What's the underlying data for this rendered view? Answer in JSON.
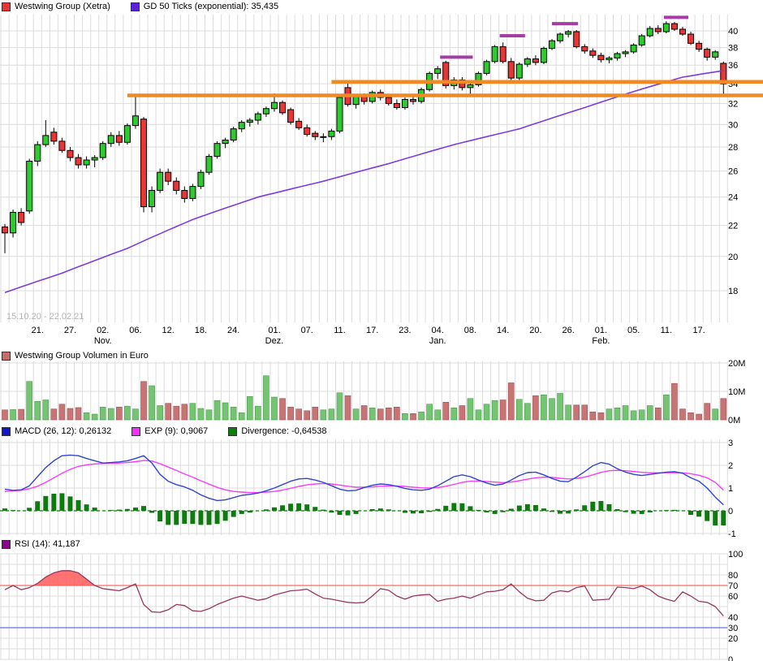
{
  "header": {
    "series_label": "Westwing Group (Xetra)",
    "ma_label": "GD 50 Ticks (exponential): 35,435"
  },
  "price_panel": {
    "date_range": "15.10.20 - 22.02.21",
    "yticks": [
      40,
      38,
      36,
      34,
      32,
      30,
      28,
      26,
      24,
      22,
      20,
      18
    ]
  },
  "volume_panel": {
    "label": "Westwing Group Volumen in Euro",
    "yticks": [
      {
        "label": "20M",
        "value": 20
      },
      {
        "label": "10M",
        "value": 10
      },
      {
        "label": "0M",
        "value": 0
      }
    ]
  },
  "macd_panel": {
    "macd_label": "MACD (26, 12): 0,26132",
    "exp_label": "EXP (9): 0,9067",
    "divergence_label": "Divergence: -0,64538",
    "yticks": [
      3,
      2,
      1,
      0,
      -1
    ]
  },
  "rsi_panel": {
    "label": "RSI (14): 41,187",
    "yticks": [
      100,
      80,
      70,
      60,
      40,
      30,
      20,
      0
    ],
    "overbought_level": 70,
    "oversold_level": 30
  },
  "colors": {
    "grid": "#dcdcdc",
    "candle_up": "#2fca2f",
    "candle_down": "#e83535",
    "candle_stroke": "#000000",
    "ma_line": "#7d3be0",
    "resistance_orange": "#f18a22",
    "peak_marker": "#a53da5",
    "vol_up": "#74c474",
    "vol_down": "#c97474",
    "macd_line": "#2f45d4",
    "exp_line": "#f93df9",
    "hist": "#0f7a0f",
    "rsi_line": "#96385f",
    "rsi_fill": "#ff5a5a",
    "level70": "#f07060",
    "level30": "#6a6af0",
    "muted_text": "#b4b4b4",
    "swatch_series": "#e83535",
    "swatch_ma": "#5b21d8",
    "swatch_volume": "#c96a6a",
    "swatch_macd": "#1515d0",
    "swatch_exp": "#f92df9",
    "swatch_div": "#0f7a0f",
    "swatch_rsi": "#8b008b"
  },
  "chart_data": [
    {
      "type": "candlestick",
      "title": "Westwing Group (Xetra)",
      "scale": "log",
      "ylim": [
        17.5,
        42.2
      ],
      "legend_position": "top-left",
      "grid": true,
      "candles": [
        [
          21.9,
          22.1,
          20.2,
          21.5
        ],
        [
          21.5,
          23.1,
          21.2,
          22.9
        ],
        [
          22.9,
          23.2,
          22.0,
          22.2
        ],
        [
          23.0,
          27.0,
          22.8,
          26.8
        ],
        [
          26.8,
          28.5,
          26.4,
          28.2
        ],
        [
          28.2,
          30.4,
          28.0,
          29.0
        ],
        [
          29.3,
          29.7,
          28.2,
          28.5
        ],
        [
          28.5,
          28.8,
          27.5,
          27.7
        ],
        [
          27.7,
          28.0,
          26.8,
          27.1
        ],
        [
          27.1,
          27.4,
          26.2,
          26.5
        ],
        [
          26.5,
          27.2,
          26.2,
          26.9
        ],
        [
          26.9,
          27.3,
          26.3,
          27.1
        ],
        [
          27.1,
          28.5,
          26.9,
          28.3
        ],
        [
          28.3,
          29.3,
          28.0,
          29.0
        ],
        [
          29.0,
          29.4,
          28.1,
          28.4
        ],
        [
          28.4,
          30.1,
          28.2,
          29.9
        ],
        [
          29.9,
          32.9,
          29.6,
          30.8
        ],
        [
          30.5,
          30.7,
          22.9,
          23.3
        ],
        [
          23.3,
          24.8,
          22.9,
          24.5
        ],
        [
          24.5,
          26.2,
          24.3,
          25.9
        ],
        [
          25.9,
          26.2,
          24.9,
          25.2
        ],
        [
          25.2,
          25.5,
          24.2,
          24.5
        ],
        [
          24.5,
          24.8,
          23.6,
          23.9
        ],
        [
          23.9,
          25.0,
          23.7,
          24.8
        ],
        [
          24.8,
          26.1,
          24.6,
          25.9
        ],
        [
          25.9,
          27.4,
          25.7,
          27.2
        ],
        [
          27.2,
          28.5,
          27.0,
          28.3
        ],
        [
          28.3,
          28.8,
          27.9,
          28.6
        ],
        [
          28.6,
          29.8,
          28.4,
          29.6
        ],
        [
          29.6,
          30.4,
          29.3,
          30.2
        ],
        [
          30.2,
          30.6,
          29.8,
          30.4
        ],
        [
          30.4,
          31.2,
          30.0,
          31.0
        ],
        [
          31.0,
          31.7,
          30.7,
          31.5
        ],
        [
          31.5,
          33.0,
          31.2,
          32.1
        ],
        [
          32.1,
          32.3,
          30.9,
          31.1
        ],
        [
          31.4,
          31.6,
          30.0,
          30.2
        ],
        [
          30.3,
          30.6,
          29.5,
          29.7
        ],
        [
          29.7,
          30.0,
          28.9,
          29.1
        ],
        [
          29.2,
          29.4,
          28.6,
          28.9
        ],
        [
          28.9,
          29.2,
          28.4,
          28.9
        ],
        [
          28.9,
          29.6,
          28.6,
          29.4
        ],
        [
          29.4,
          32.8,
          29.2,
          32.6
        ],
        [
          33.6,
          34.3,
          31.7,
          31.9
        ],
        [
          31.9,
          32.9,
          31.5,
          32.7
        ],
        [
          32.7,
          33.0,
          31.9,
          32.2
        ],
        [
          32.2,
          33.3,
          32.0,
          33.1
        ],
        [
          33.1,
          33.4,
          32.3,
          32.6
        ],
        [
          32.6,
          32.9,
          31.8,
          32.0
        ],
        [
          32.0,
          32.4,
          31.4,
          31.6
        ],
        [
          31.6,
          32.6,
          31.4,
          32.4
        ],
        [
          32.4,
          32.8,
          31.9,
          32.2
        ],
        [
          32.2,
          33.6,
          32.0,
          33.4
        ],
        [
          33.4,
          35.3,
          33.2,
          35.1
        ],
        [
          35.1,
          35.9,
          34.5,
          35.6
        ],
        [
          36.3,
          36.5,
          33.5,
          33.8
        ],
        [
          33.8,
          34.7,
          33.4,
          34.4
        ],
        [
          34.4,
          34.7,
          33.3,
          33.6
        ],
        [
          33.6,
          34.1,
          32.9,
          33.9
        ],
        [
          33.9,
          35.3,
          33.7,
          35.1
        ],
        [
          35.1,
          36.6,
          34.9,
          36.4
        ],
        [
          36.4,
          38.3,
          36.2,
          38.1
        ],
        [
          38.1,
          38.6,
          36.2,
          36.4
        ],
        [
          36.4,
          36.8,
          34.2,
          34.6
        ],
        [
          34.6,
          36.3,
          34.4,
          36.1
        ],
        [
          36.1,
          36.9,
          35.8,
          36.7
        ],
        [
          36.7,
          37.1,
          36.0,
          36.3
        ],
        [
          36.3,
          38.1,
          36.1,
          37.9
        ],
        [
          37.9,
          39.0,
          37.7,
          38.8
        ],
        [
          38.8,
          39.8,
          38.5,
          39.6
        ],
        [
          39.6,
          40.1,
          39.2,
          39.9
        ],
        [
          39.9,
          40.1,
          37.9,
          38.1
        ],
        [
          38.1,
          38.4,
          37.3,
          37.6
        ],
        [
          37.6,
          37.9,
          36.8,
          37.1
        ],
        [
          37.1,
          37.4,
          36.3,
          36.6
        ],
        [
          36.6,
          37.0,
          36.2,
          36.8
        ],
        [
          36.8,
          37.5,
          36.5,
          37.3
        ],
        [
          37.3,
          37.7,
          36.9,
          37.5
        ],
        [
          37.5,
          38.5,
          37.3,
          38.3
        ],
        [
          38.3,
          39.6,
          38.1,
          39.4
        ],
        [
          39.4,
          40.6,
          39.2,
          40.3
        ],
        [
          40.3,
          40.7,
          39.6,
          39.9
        ],
        [
          39.9,
          41.2,
          39.7,
          40.9
        ],
        [
          40.9,
          41.1,
          40.0,
          40.2
        ],
        [
          40.2,
          40.5,
          39.4,
          39.6
        ],
        [
          39.6,
          39.9,
          38.3,
          38.5
        ],
        [
          38.5,
          38.8,
          37.5,
          37.8
        ],
        [
          37.8,
          38.0,
          36.5,
          36.9
        ],
        [
          36.9,
          37.7,
          36.6,
          37.5
        ],
        [
          36.2,
          36.4,
          32.9,
          34.0
        ]
      ],
      "x_labels": [
        {
          "i": 4,
          "label": "21."
        },
        {
          "i": 8,
          "label": "27."
        },
        {
          "i": 12,
          "label": "02.",
          "month": "Nov."
        },
        {
          "i": 16,
          "label": "06."
        },
        {
          "i": 20,
          "label": "12."
        },
        {
          "i": 24,
          "label": "18."
        },
        {
          "i": 28,
          "label": "24."
        },
        {
          "i": 33,
          "label": "01.",
          "month": "Dez."
        },
        {
          "i": 37,
          "label": "07."
        },
        {
          "i": 41,
          "label": "11."
        },
        {
          "i": 45,
          "label": "17."
        },
        {
          "i": 49,
          "label": "23."
        },
        {
          "i": 53,
          "label": "04.",
          "month": "Jan."
        },
        {
          "i": 57,
          "label": "08."
        },
        {
          "i": 61,
          "label": "14."
        },
        {
          "i": 65,
          "label": "20."
        },
        {
          "i": 69,
          "label": "26."
        },
        {
          "i": 73,
          "label": "01.",
          "month": "Feb."
        },
        {
          "i": 77,
          "label": "05."
        },
        {
          "i": 81,
          "label": "11."
        },
        {
          "i": 85,
          "label": "17."
        }
      ],
      "ma50_points": [
        [
          0,
          17.9
        ],
        [
          7,
          19.0
        ],
        [
          15,
          20.5
        ],
        [
          23,
          22.4
        ],
        [
          31,
          24.0
        ],
        [
          39,
          25.2
        ],
        [
          47,
          26.6
        ],
        [
          55,
          28.2
        ],
        [
          63,
          29.6
        ],
        [
          71,
          31.6
        ],
        [
          77,
          33.2
        ],
        [
          83,
          34.7
        ],
        [
          88,
          35.4
        ]
      ],
      "ma50_last_value": 35.435,
      "hlines": [
        {
          "value": 32.8,
          "from_index": 15
        },
        {
          "value": 34.2,
          "from_index": 40
        }
      ],
      "peak_markers": [
        {
          "from": 53.3,
          "to": 57.3,
          "value": 36.9
        },
        {
          "from": 60.6,
          "to": 63.7,
          "value": 39.4
        },
        {
          "from": 67.0,
          "to": 70.2,
          "value": 40.9
        },
        {
          "from": 80.7,
          "to": 83.7,
          "value": 41.7
        }
      ]
    },
    {
      "type": "bar",
      "title": "Westwing Group Volumen in Euro",
      "unit": "M",
      "ylim": [
        0,
        20
      ],
      "values": [
        3.5,
        3.6,
        3.7,
        13.5,
        6.5,
        7.0,
        3.8,
        5.5,
        4.0,
        4.3,
        2.5,
        2.0,
        4.5,
        4.0,
        4.5,
        4.8,
        3.8,
        13.5,
        12.0,
        5.0,
        5.8,
        4.8,
        5.5,
        5.8,
        4.0,
        3.5,
        6.8,
        6.0,
        4.5,
        2.5,
        8.2,
        4.8,
        15.5,
        8.0,
        7.5,
        4.5,
        3.8,
        3.2,
        4.5,
        3.5,
        3.8,
        9.5,
        8.5,
        3.8,
        5.0,
        4.2,
        3.8,
        4.2,
        4.5,
        2.2,
        2.2,
        2.8,
        5.5,
        3.5,
        6.2,
        4.2,
        5.0,
        7.5,
        3.5,
        5.5,
        6.8,
        7.0,
        13.0,
        7.2,
        5.8,
        8.5,
        8.8,
        7.5,
        9.3,
        5.2,
        5.2,
        5.2,
        2.8,
        2.5,
        3.8,
        4.2,
        5.0,
        3.2,
        3.5,
        5.0,
        4.2,
        8.8,
        12.8,
        3.8,
        2.5,
        2.0,
        5.8,
        3.8,
        7.5
      ]
    },
    {
      "type": "line",
      "title": "MACD",
      "ylim": [
        -1,
        3
      ],
      "final_values": {
        "macd": 0.26132,
        "exp": 0.9067,
        "divergence": -0.64538
      },
      "macd": [
        0.95,
        0.9,
        0.92,
        1.1,
        1.5,
        1.9,
        2.2,
        2.42,
        2.45,
        2.42,
        2.3,
        2.2,
        2.1,
        2.12,
        2.15,
        2.2,
        2.3,
        2.42,
        2.1,
        1.6,
        1.3,
        1.15,
        1.05,
        0.9,
        0.7,
        0.55,
        0.45,
        0.48,
        0.58,
        0.68,
        0.72,
        0.78,
        0.88,
        1.0,
        1.15,
        1.3,
        1.4,
        1.42,
        1.35,
        1.25,
        1.1,
        0.95,
        0.88,
        0.9,
        1.02,
        1.12,
        1.18,
        1.15,
        1.08,
        0.98,
        0.92,
        0.9,
        0.95,
        1.1,
        1.3,
        1.5,
        1.58,
        1.5,
        1.35,
        1.22,
        1.12,
        1.18,
        1.35,
        1.55,
        1.68,
        1.7,
        1.58,
        1.42,
        1.3,
        1.28,
        1.48,
        1.72,
        1.98,
        2.12,
        2.05,
        1.85,
        1.7,
        1.6,
        1.55,
        1.6,
        1.65,
        1.7,
        1.72,
        1.65,
        1.45,
        1.3,
        1.0,
        0.6,
        0.26132
      ],
      "exp": [
        0.85,
        0.87,
        0.9,
        0.97,
        1.08,
        1.25,
        1.45,
        1.65,
        1.82,
        1.95,
        2.02,
        2.06,
        2.08,
        2.09,
        2.1,
        2.12,
        2.16,
        2.21,
        2.19,
        2.07,
        1.92,
        1.77,
        1.62,
        1.48,
        1.32,
        1.17,
        1.03,
        0.92,
        0.85,
        0.82,
        0.8,
        0.8,
        0.82,
        0.85,
        0.91,
        0.99,
        1.07,
        1.14,
        1.18,
        1.2,
        1.18,
        1.13,
        1.08,
        1.04,
        1.04,
        1.05,
        1.08,
        1.09,
        1.09,
        1.07,
        1.04,
        1.01,
        1.0,
        1.02,
        1.08,
        1.16,
        1.25,
        1.3,
        1.31,
        1.29,
        1.26,
        1.24,
        1.26,
        1.32,
        1.39,
        1.45,
        1.48,
        1.47,
        1.43,
        1.4,
        1.42,
        1.48,
        1.58,
        1.69,
        1.76,
        1.78,
        1.76,
        1.73,
        1.69,
        1.67,
        1.67,
        1.67,
        1.68,
        1.67,
        1.63,
        1.56,
        1.45,
        1.25,
        0.9067
      ]
    },
    {
      "type": "line",
      "title": "RSI (14)",
      "ylim": [
        0,
        100
      ],
      "final_value": 41.187,
      "values": [
        66,
        70,
        66,
        68,
        72,
        78,
        82,
        84,
        84,
        82,
        76,
        70,
        67,
        66,
        65,
        68,
        71.5,
        52,
        45,
        44.5,
        47,
        52,
        51,
        46,
        45.5,
        48,
        52,
        55,
        58,
        60,
        58,
        56,
        57.5,
        61,
        63,
        65,
        65.5,
        66.5,
        62,
        58,
        57,
        55.5,
        54,
        53.5,
        54,
        60,
        67,
        65.5,
        60,
        57,
        60,
        61,
        61.5,
        55,
        57,
        58,
        60,
        58,
        61,
        64,
        64.5,
        66,
        71.5,
        64,
        58,
        55.5,
        56,
        63,
        65,
        64,
        68,
        69.5,
        56,
        56.5,
        57,
        68.5,
        68,
        67,
        69.5,
        66,
        60,
        57,
        55,
        64,
        60,
        55,
        54,
        50,
        41.187
      ]
    }
  ]
}
